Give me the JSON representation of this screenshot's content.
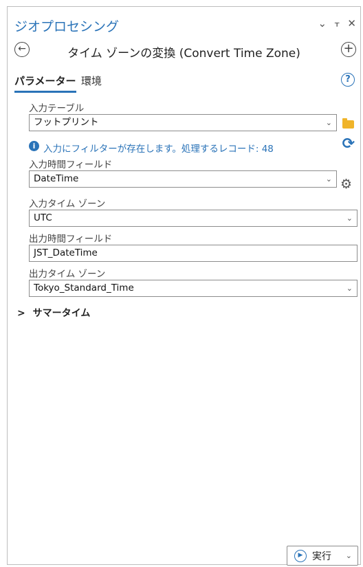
{
  "header": {
    "title": "ジオプロセシング",
    "controls": {
      "menu": "⌄",
      "pin": "ᵩ",
      "close": "✕"
    }
  },
  "tool": {
    "name": "タイム ゾーンの変換 (Convert Time Zone)",
    "back_icon": "back-arrow-icon",
    "add_icon": "add-icon"
  },
  "tabs": [
    {
      "label": "パラメーター",
      "active": true
    },
    {
      "label": "環境",
      "active": false
    }
  ],
  "help": "?",
  "params": {
    "input_table": {
      "label": "入力テーブル",
      "value": "フットプリント"
    },
    "info": "入力にフィルターが存在します。処理するレコード: 48",
    "input_time_field": {
      "label": "入力時間フィールド",
      "value": "DateTime"
    },
    "input_time_zone": {
      "label": "入力タイム ゾーン",
      "value": "UTC"
    },
    "output_time_field": {
      "label": "出力時間フィールド",
      "value": "JST_DateTime"
    },
    "output_time_zone": {
      "label": "出力タイム ゾーン",
      "value": "Tokyo_Standard_Time"
    },
    "dst": {
      "label": "サマータイム",
      "arrow": ">"
    }
  },
  "footer": {
    "run_label": "実行"
  },
  "colors": {
    "accent": "#2a73b8",
    "folder": "#f0b429"
  }
}
